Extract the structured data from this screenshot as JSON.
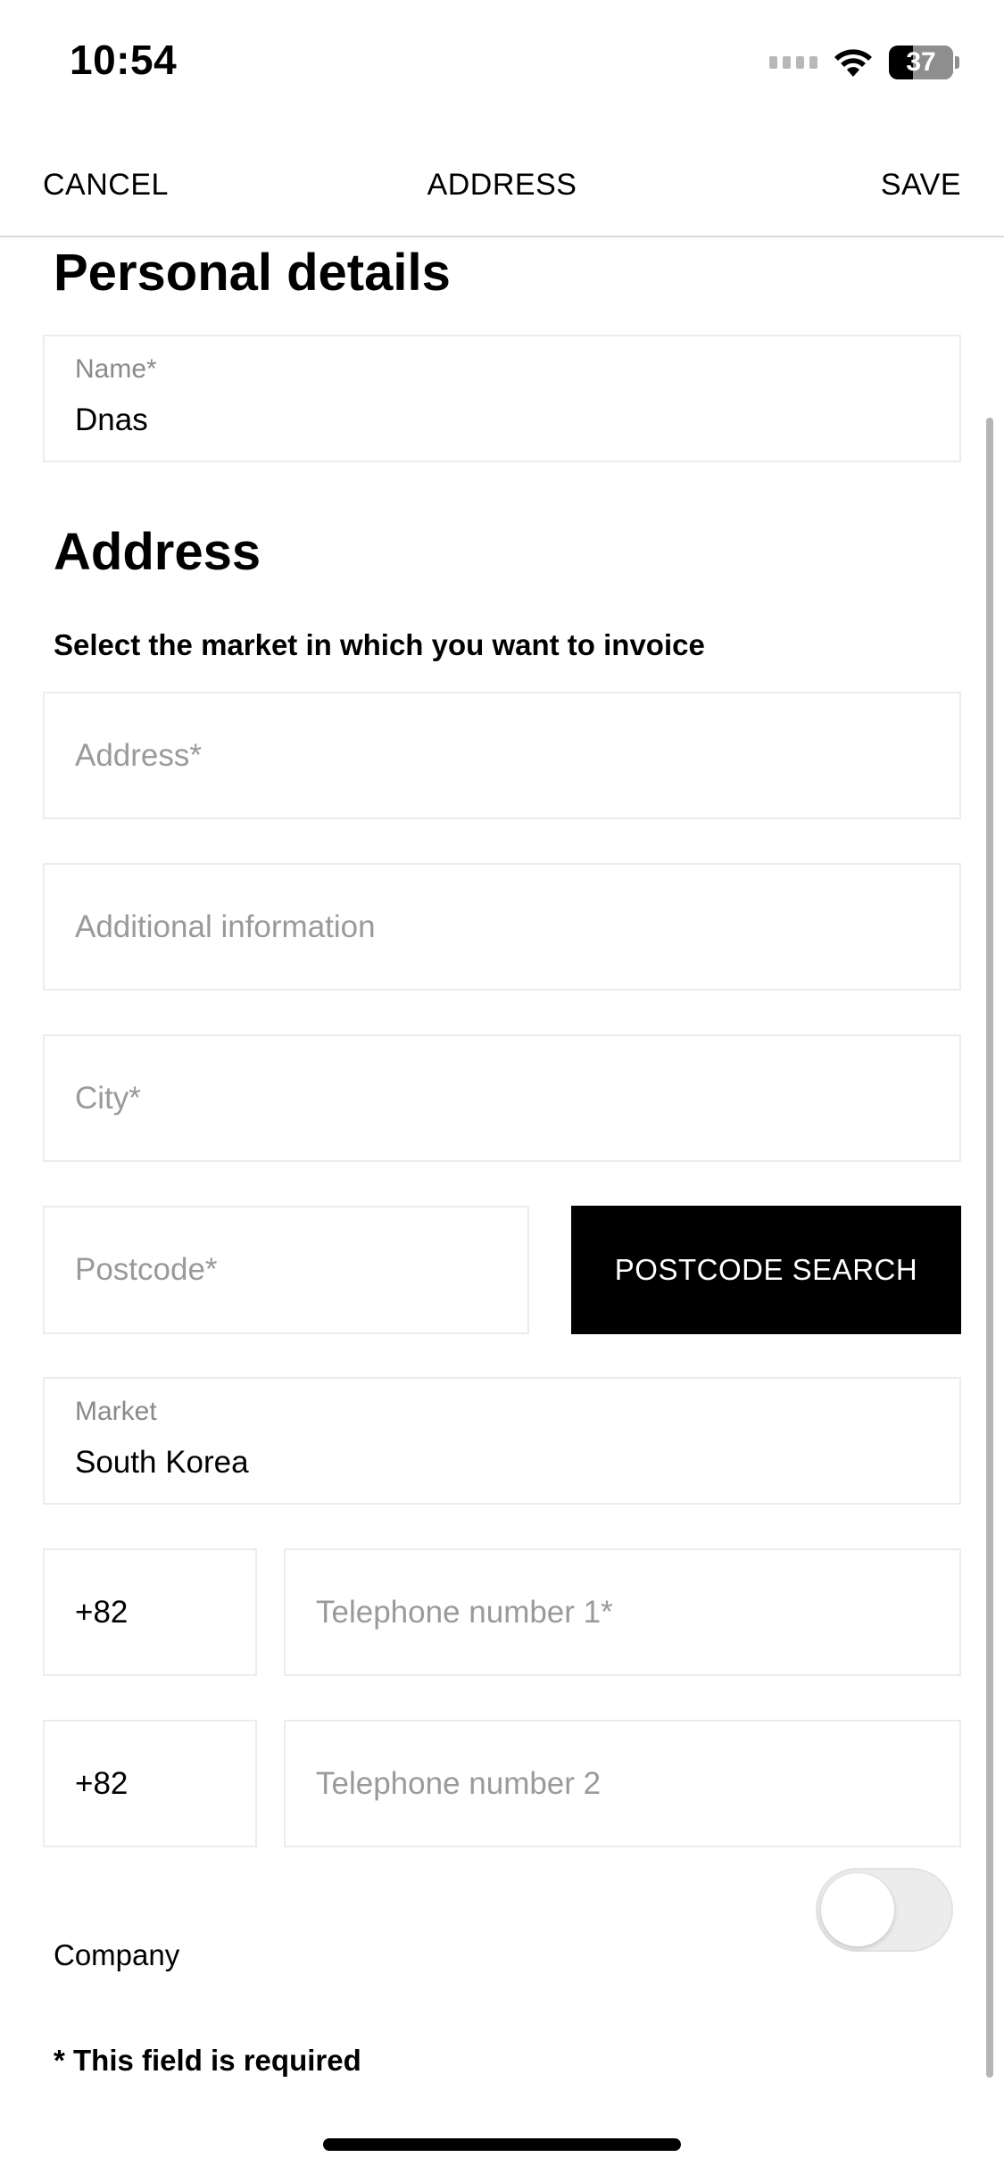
{
  "status_bar": {
    "time": "10:54",
    "battery_level": "37",
    "battery_fraction": 0.37,
    "icons": [
      "cellular-signal-icon",
      "wifi-icon",
      "battery-icon"
    ]
  },
  "nav": {
    "cancel_label": "CANCEL",
    "title": "ADDRESS",
    "save_label": "SAVE"
  },
  "personal_details": {
    "heading": "Personal details",
    "name_label": "Name*",
    "name_value": "Dnas"
  },
  "address": {
    "heading": "Address",
    "subtitle": "Select the market in which you want to invoice",
    "address_placeholder": "Address*",
    "additional_placeholder": "Additional information",
    "city_placeholder": "City*",
    "postcode_placeholder": "Postcode*",
    "postcode_search_label": "POSTCODE SEARCH",
    "market_label": "Market",
    "market_value": "South Korea",
    "phone1_prefix": "+82",
    "phone1_placeholder": "Telephone number 1*",
    "phone2_prefix": "+82",
    "phone2_placeholder": "Telephone number 2",
    "company_label": "Company",
    "company_enabled": false,
    "required_note": "* This field is required"
  },
  "colors": {
    "accent": "#000000",
    "border": "#ececec",
    "placeholder": "#9a9a9a"
  }
}
